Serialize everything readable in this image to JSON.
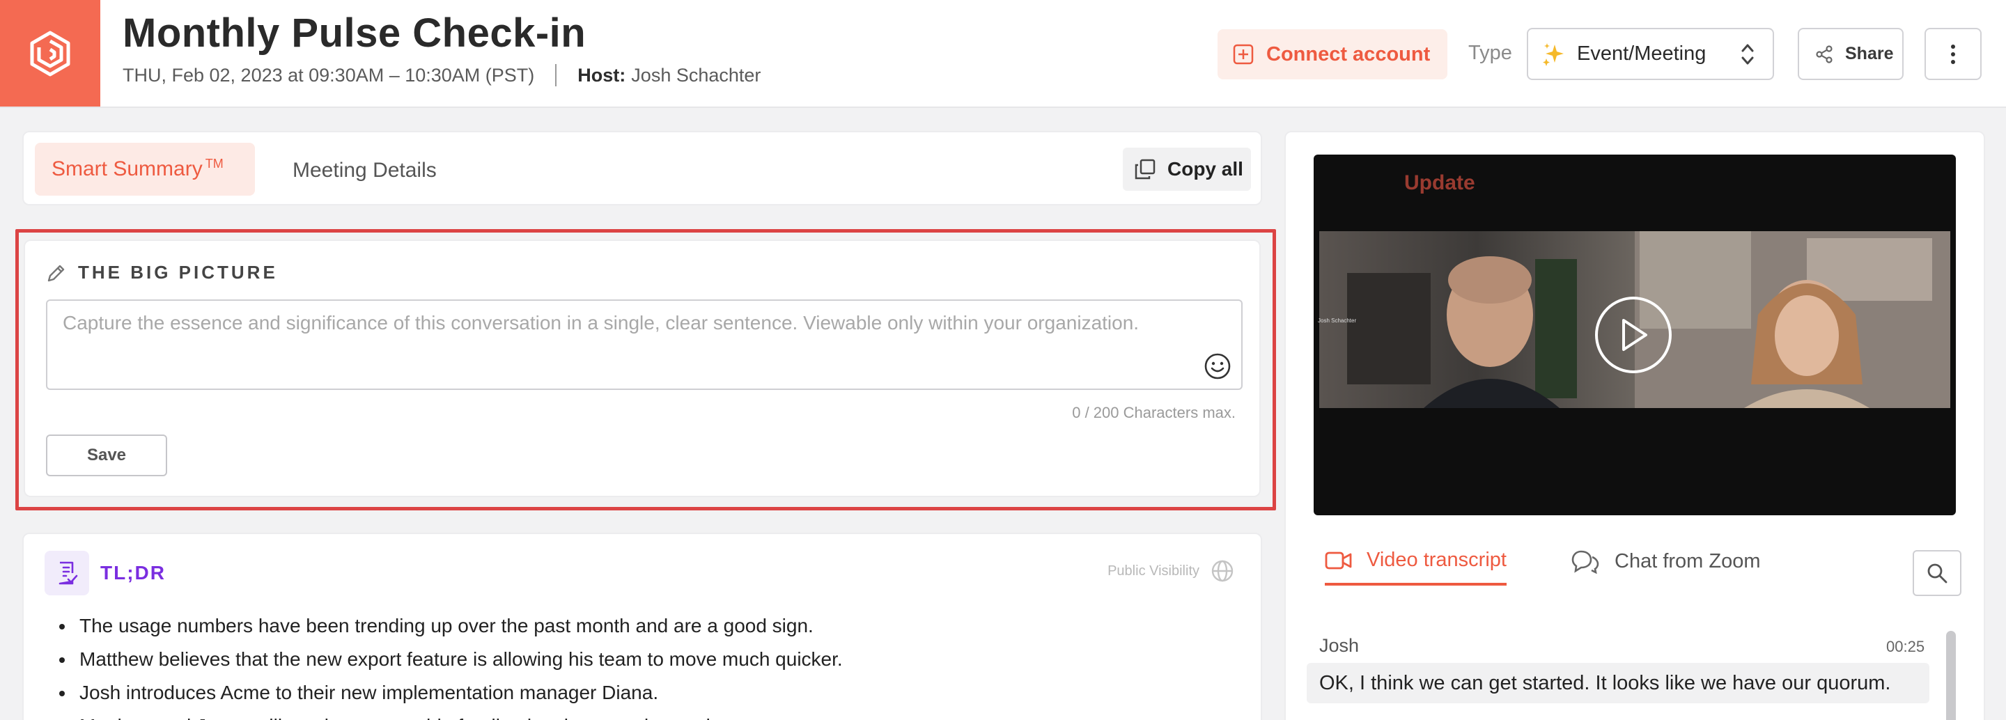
{
  "header": {
    "title": "Monthly Pulse Check-in",
    "date_time": "THU, Feb 02, 2023 at 09:30AM – 10:30AM (PST)",
    "host_label": "Host:",
    "host_name": "Josh Schachter",
    "connect_label": "Connect account",
    "type_label": "Type",
    "type_value": "Event/Meeting",
    "share_label": "Share",
    "brand_color": "#f46a52"
  },
  "tabs": {
    "smart_summary": "Smart Summary",
    "smart_summary_tm": "TM",
    "meeting_details": "Meeting Details",
    "copy_all": "Copy all"
  },
  "big_picture": {
    "title": "THE BIG PICTURE",
    "placeholder": "Capture the essence and significance of this conversation in a single, clear sentence. Viewable only within your organization.",
    "value": "",
    "char_count": "0 / 200 Characters max.",
    "save_label": "Save"
  },
  "tldr": {
    "title": "TL;DR",
    "visibility_label": "Public Visibility",
    "items": [
      "The usage numbers have been trending up over the past month and are a good sign.",
      "Matthew believes that the new export feature is allowing his team to move much quicker.",
      "Josh introduces Acme to their new implementation manager Diana.",
      "Matthew and Jenna will continue to provide feedback to improve the product."
    ],
    "title_color": "#7a2ee0"
  },
  "video": {
    "brand_overlay": "Update",
    "participant_tag": "Josh Schachter"
  },
  "transcript": {
    "tab_video": "Video transcript",
    "tab_chat": "Chat from Zoom",
    "entries": [
      {
        "speaker": "Josh",
        "time": "00:25",
        "text": "OK, I think we can get started. It looks like we have our quorum."
      }
    ]
  }
}
